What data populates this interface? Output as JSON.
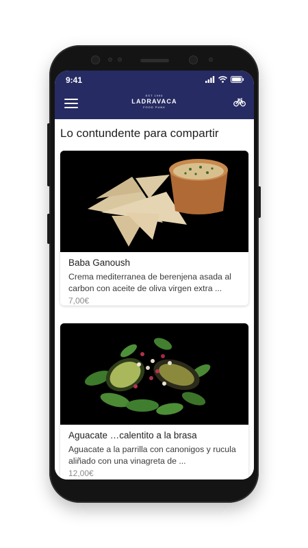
{
  "status_bar": {
    "time": "9:41"
  },
  "header": {
    "logo": {
      "est": "EST 1990",
      "name": "LADRAVACA",
      "tagline": "FOOD PUNK"
    },
    "icons": {
      "menu": "hamburger-menu-icon",
      "delivery": "bicycle-icon"
    }
  },
  "section": {
    "title": "Lo contundente para compartir"
  },
  "items": [
    {
      "name": "Baba Ganoush",
      "description": "Crema mediterranea de berenjena asada al carbon con aceite de oliva virgen extra ...",
      "price": "7,00€"
    },
    {
      "name": "Aguacate …calentito a la brasa",
      "description": "Aguacate a la parrilla con canonigos y rucula aliñado con una vinagreta de ...",
      "price": "12,00€"
    }
  ],
  "colors": {
    "header": "#262b63",
    "phone_frame": "#141414",
    "price_text": "#8a8a8a"
  }
}
